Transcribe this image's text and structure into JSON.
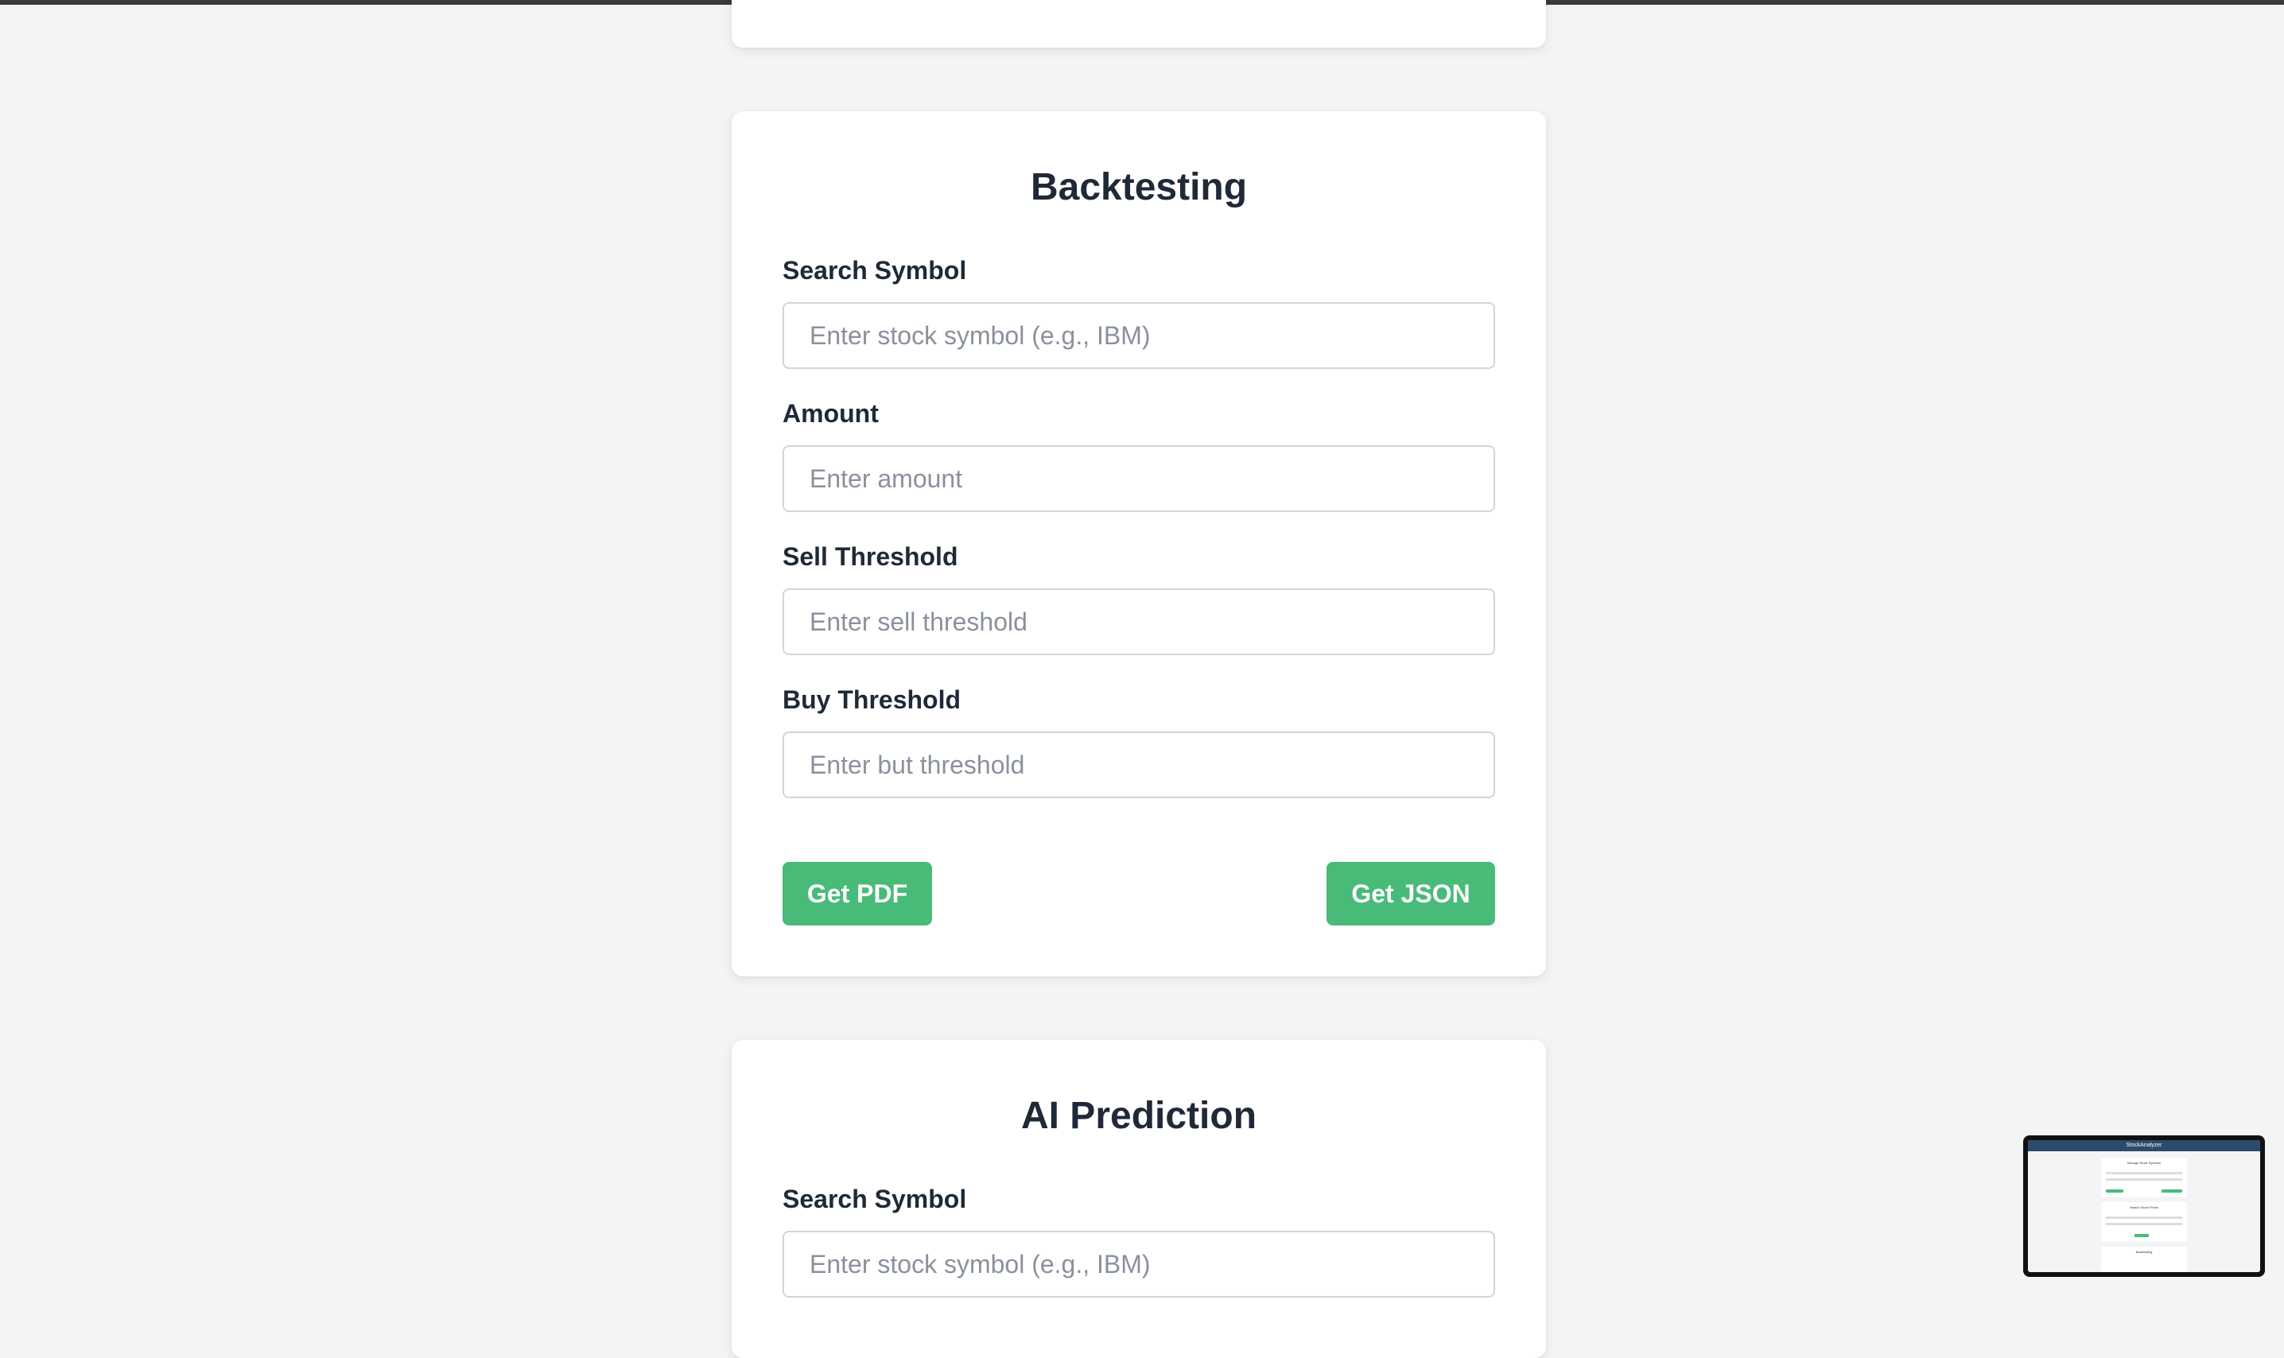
{
  "backtesting": {
    "title": "Backtesting",
    "fields": [
      {
        "label": "Search Symbol",
        "placeholder": "Enter stock symbol (e.g., IBM)"
      },
      {
        "label": "Amount",
        "placeholder": "Enter amount"
      },
      {
        "label": "Sell Threshold",
        "placeholder": "Enter sell threshold"
      },
      {
        "label": "Buy Threshold",
        "placeholder": "Enter but threshold"
      }
    ],
    "pdf_button": "Get PDF",
    "json_button": "Get JSON"
  },
  "ai_prediction": {
    "title": "AI Prediction",
    "fields": [
      {
        "label": "Search Symbol",
        "placeholder": "Enter stock symbol (e.g., IBM)"
      }
    ]
  },
  "minimap": {
    "nav_title": "StockAnalyzer",
    "cards": [
      "Manage Stock Symbols",
      "Search Stock Prices",
      "Backtesting"
    ]
  },
  "colors": {
    "background": "#f3f4f6",
    "card": "#ffffff",
    "accent_button": "#48bb78",
    "text": "#1f2937",
    "placeholder": "#8a919c"
  }
}
